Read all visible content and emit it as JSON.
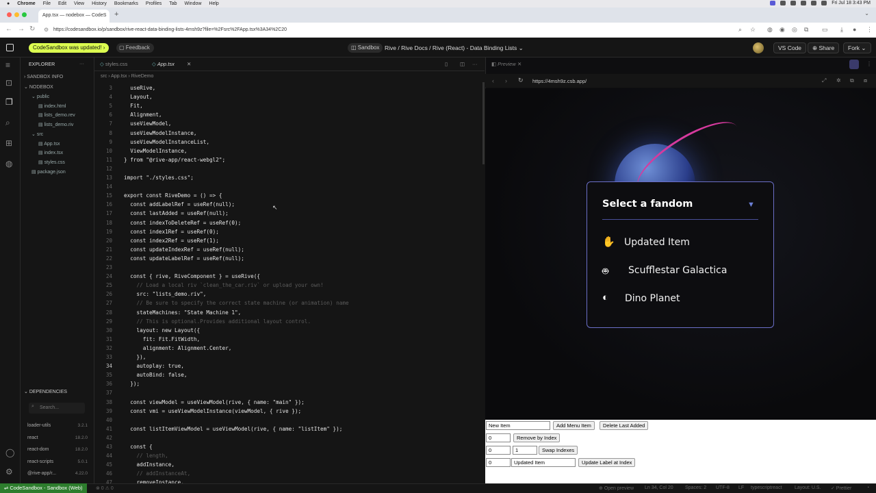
{
  "menubar": {
    "app": "Chrome",
    "items": [
      "File",
      "Edit",
      "View",
      "History",
      "Bookmarks",
      "Profiles",
      "Tab",
      "Window",
      "Help"
    ],
    "clock": "Fri Jul 18  3:43 PM"
  },
  "browser": {
    "tab_title": "App.tsx — nodebox — CodeS",
    "url": "https://codesandbox.io/p/sandbox/rive-react-data-binding-lists-4msh9z?file=%2Fsrc%2FApp.tsx%3A34%2C20"
  },
  "header": {
    "update_badge": "CodeSandbox was updated!",
    "feedback": "Feedback",
    "sandbox_pill": "Sandbox",
    "title": "Rive / Rive Docs / Rive (React) - Data Binding Lists",
    "vscode": "VS Code",
    "share": "Share",
    "fork": "Fork"
  },
  "explorer": {
    "heading": "EXPLORER",
    "sandbox_info": "SANDBOX INFO",
    "nodebox": "NODEBOX",
    "tree": [
      {
        "label": "public",
        "indent": 1
      },
      {
        "label": "index.html",
        "indent": 2
      },
      {
        "label": "lists_demo.rev",
        "indent": 2
      },
      {
        "label": "lists_demo.riv",
        "indent": 2
      },
      {
        "label": "src",
        "indent": 1
      },
      {
        "label": "App.tsx",
        "indent": 2
      },
      {
        "label": "index.tsx",
        "indent": 2
      },
      {
        "label": "styles.css",
        "indent": 2
      },
      {
        "label": "package.json",
        "indent": 1
      }
    ],
    "dependencies_heading": "DEPENDENCIES",
    "search_placeholder": "Search...",
    "deps": [
      {
        "name": "loader-utils",
        "version": "3.2.1"
      },
      {
        "name": "react",
        "version": "18.2.0"
      },
      {
        "name": "react-dom",
        "version": "18.2.0"
      },
      {
        "name": "react-scripts",
        "version": "5.0.1"
      },
      {
        "name": "@rive-app/r...",
        "version": "4.22.0"
      }
    ]
  },
  "editor": {
    "tabs": [
      "styles.css",
      "App.tsx"
    ],
    "breadcrumb": "src  ›  App.tsx  ›  RiveDemo",
    "lines": [
      {
        "n": "3",
        "t": "  useRive,"
      },
      {
        "n": "4",
        "t": "  Layout,"
      },
      {
        "n": "5",
        "t": "  Fit,"
      },
      {
        "n": "6",
        "t": "  Alignment,"
      },
      {
        "n": "7",
        "t": "  useViewModel,"
      },
      {
        "n": "8",
        "t": "  useViewModelInstance,"
      },
      {
        "n": "9",
        "t": "  useViewModelInstanceList,"
      },
      {
        "n": "10",
        "t": "  ViewModelInstance,"
      },
      {
        "n": "11",
        "t": "} from \"@rive-app/react-webgl2\";"
      },
      {
        "n": "12",
        "t": ""
      },
      {
        "n": "13",
        "t": "import \"./styles.css\";"
      },
      {
        "n": "14",
        "t": ""
      },
      {
        "n": "15",
        "t": "export const RiveDemo = () => {"
      },
      {
        "n": "16",
        "t": "  const addLabelRef = useRef(null);"
      },
      {
        "n": "17",
        "t": "  const lastAdded = useRef(null);"
      },
      {
        "n": "18",
        "t": "  const indexToDeleteRef = useRef(0);"
      },
      {
        "n": "19",
        "t": "  const index1Ref = useRef(0);"
      },
      {
        "n": "20",
        "t": "  const index2Ref = useRef(1);"
      },
      {
        "n": "21",
        "t": "  const updateIndexRef = useRef(null);"
      },
      {
        "n": "22",
        "t": "  const updateLabelRef = useRef(null);"
      },
      {
        "n": "23",
        "t": ""
      },
      {
        "n": "24",
        "t": "  const { rive, RiveComponent } = useRive({"
      },
      {
        "n": "25",
        "t": "    // Load a local riv `clean_the_car.riv` or upload your own!",
        "c": true
      },
      {
        "n": "26",
        "t": "    src: \"lists_demo.riv\","
      },
      {
        "n": "27",
        "t": "    // Be sure to specify the correct state machine (or animation) name",
        "c": true
      },
      {
        "n": "28",
        "t": "    stateMachines: \"State Machine 1\","
      },
      {
        "n": "29",
        "t": "    // This is optional.Provides additional layout control.",
        "c": true
      },
      {
        "n": "30",
        "t": "    layout: new Layout({"
      },
      {
        "n": "31",
        "t": "      fit: Fit.FitWidth,"
      },
      {
        "n": "32",
        "t": "      alignment: Alignment.Center,"
      },
      {
        "n": "33",
        "t": "    }),"
      },
      {
        "n": "34",
        "t": "    autoplay: true,"
      },
      {
        "n": "35",
        "t": "    autoBind: false,"
      },
      {
        "n": "36",
        "t": "  });"
      },
      {
        "n": "37",
        "t": ""
      },
      {
        "n": "38",
        "t": "  const viewModel = useViewModel(rive, { name: \"main\" });"
      },
      {
        "n": "39",
        "t": "  const vmi = useViewModelInstance(viewModel, { rive });"
      },
      {
        "n": "40",
        "t": ""
      },
      {
        "n": "41",
        "t": "  const listItemViewModel = useViewModel(rive, { name: \"listItem\" });"
      },
      {
        "n": "42",
        "t": ""
      },
      {
        "n": "43",
        "t": "  const {"
      },
      {
        "n": "44",
        "t": "    // length,",
        "c": true
      },
      {
        "n": "45",
        "t": "    addInstance,"
      },
      {
        "n": "46",
        "t": "    // addInstanceAt,",
        "c": true
      },
      {
        "n": "47",
        "t": "    removeInstance,"
      }
    ]
  },
  "preview": {
    "tab": "Preview",
    "url": "https://4msh9z.csb.app/",
    "modal_title": "Select a fandom",
    "items": [
      {
        "icon": "hand-icon",
        "label": "Updated Item"
      },
      {
        "icon": "robot-icon",
        "label": "Scufflestar Galactica"
      },
      {
        "icon": "planet-icon",
        "label": "Dino Planet"
      }
    ]
  },
  "controls": {
    "new_item_value": "New Item",
    "add_menu_item": "Add Menu Item",
    "delete_last_added": "Delete Last Added",
    "remove_index_value": "0",
    "remove_by_index": "Remove by Index",
    "swap_index1_value": "0",
    "swap_index2_value": "1",
    "swap_indexes": "Swap Indexes",
    "update_index_value": "0",
    "update_label_value": "Updated Item",
    "update_label_at_index": "Update Label at Index"
  },
  "status": {
    "sandbox": "CodeSandbox - Sandbox (Web)",
    "problems": "⊗ 0  ⚠ 0",
    "open_preview": "Open preview",
    "position": "Ln 34, Col 20",
    "spaces": "Spaces: 2",
    "encoding": "UTF-8",
    "eol": "LF",
    "language": "typescriptreact",
    "layout": "Layout: U.S.",
    "prettier": "✓ Prettier"
  }
}
